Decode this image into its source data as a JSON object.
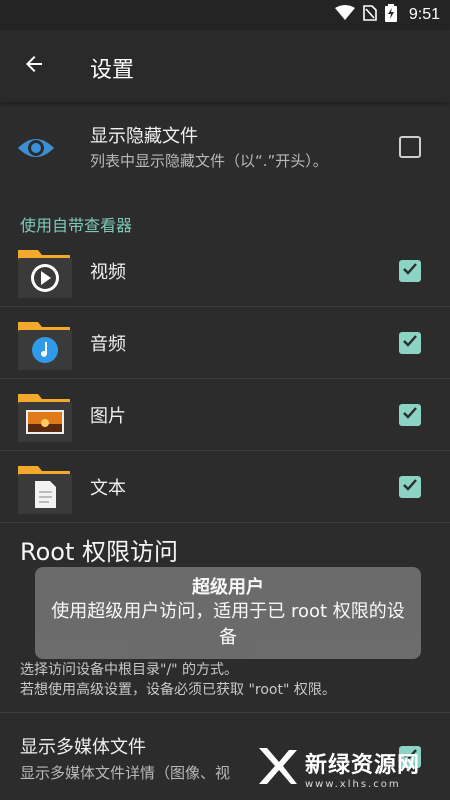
{
  "status_bar": {
    "time": "9:51"
  },
  "app_bar": {
    "title": "设置"
  },
  "show_hidden": {
    "title": "显示隐藏文件",
    "subtitle": "列表中显示隐藏文件（以“.”开头）。",
    "checked": false
  },
  "viewer_section": {
    "header": "使用自带查看器",
    "items": [
      {
        "label": "视频",
        "icon": "video-folder-icon",
        "checked": true
      },
      {
        "label": "音频",
        "icon": "audio-folder-icon",
        "checked": true
      },
      {
        "label": "图片",
        "icon": "image-folder-icon",
        "checked": true
      },
      {
        "label": "文本",
        "icon": "text-folder-icon",
        "checked": true
      }
    ]
  },
  "root_section": {
    "title": "Root 权限访问",
    "desc_line1": "选择访问设备中根目录\"/\" 的方式。",
    "desc_line2": "若想使用高级设置，设备必须已获取 \"root\" 权限。"
  },
  "toast": {
    "title": "超级用户",
    "body": "使用超级用户访问，适用于已 root 权限的设备"
  },
  "media_row": {
    "title": "显示多媒体文件",
    "subtitle": "显示多媒体文件详情（图像、视",
    "checked": true
  },
  "watermark": {
    "text": "新绿资源网",
    "url": "www.xlhs.com"
  },
  "colors": {
    "accent": "#7ec9b8",
    "checkbox_on": "#8bd3c4",
    "eye": "#3b8fd6",
    "folder": "#f4a82c"
  }
}
